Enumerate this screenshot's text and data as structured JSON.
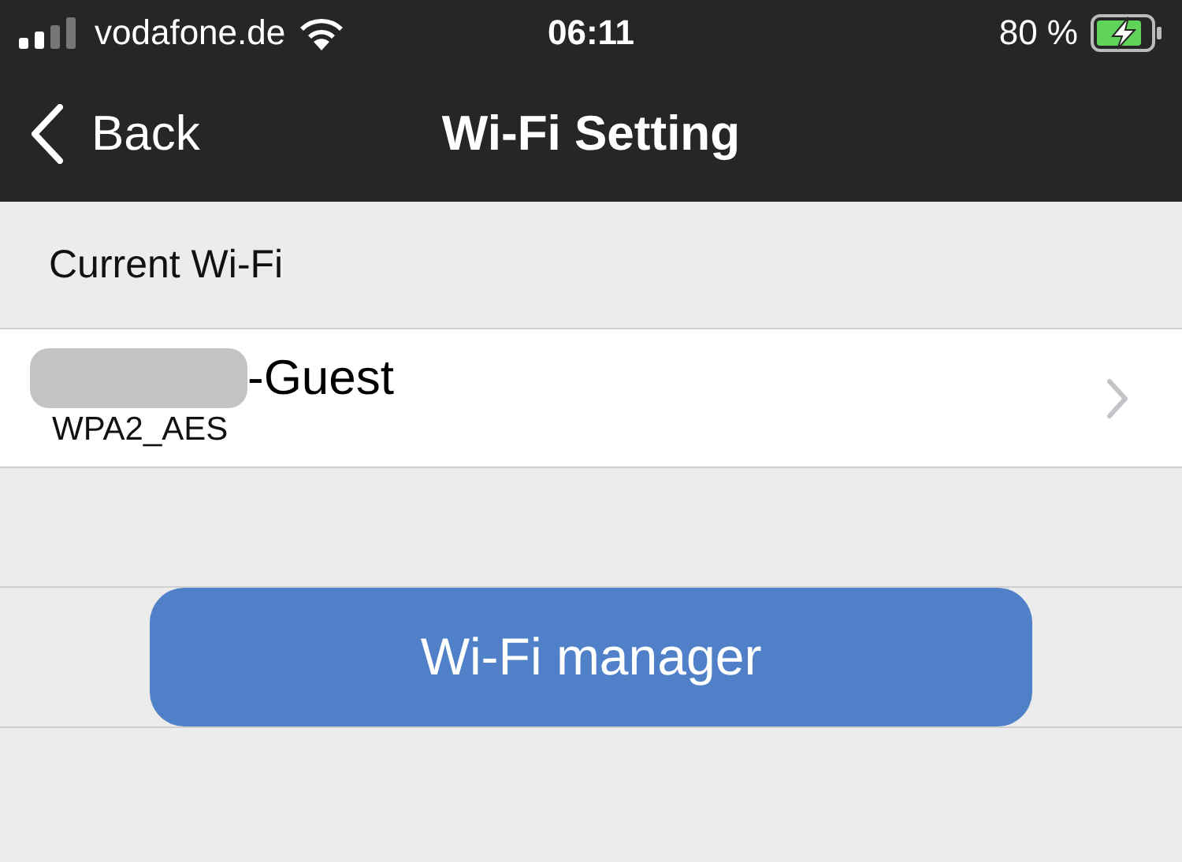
{
  "status_bar": {
    "carrier": "vodafone.de",
    "time": "06:11",
    "battery": "80 %"
  },
  "nav_bar": {
    "back": "Back",
    "title": "Wi-Fi Setting"
  },
  "section": {
    "header": "Current Wi-Fi"
  },
  "current_network": {
    "name": "-Guest",
    "security": "WPA2_AES",
    "redacted": true
  },
  "buttons": [
    {
      "label": "Wi-Fi manager"
    }
  ]
}
